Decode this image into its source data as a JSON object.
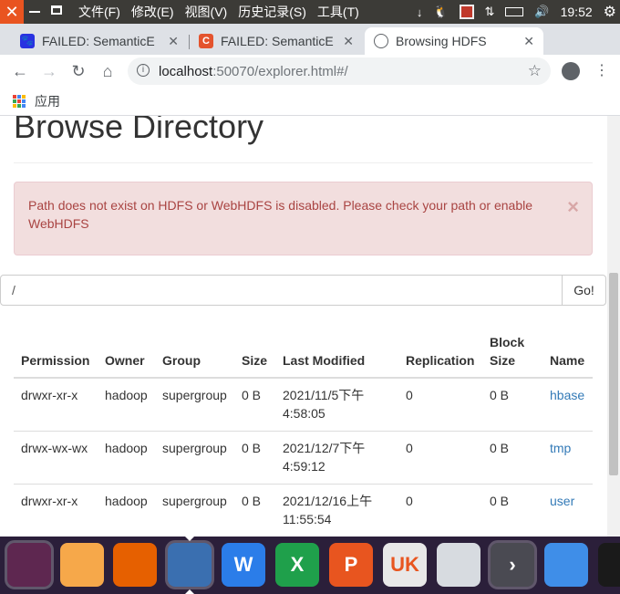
{
  "system_bar": {
    "menus": [
      "文件(F)",
      "修改(E)",
      "视图(V)",
      "历史记录(S)",
      "工具(T)"
    ],
    "clock": "19:52"
  },
  "tabs": [
    {
      "title": "FAILED: SemanticE",
      "favicon": "baidu-paw-icon",
      "active": false
    },
    {
      "title": "FAILED: SemanticE",
      "favicon": "c-letter-icon",
      "active": false
    },
    {
      "title": "Browsing HDFS",
      "favicon": "globe-icon",
      "active": true
    }
  ],
  "omnibox": {
    "host": "localhost",
    "rest": ":50070/explorer.html#/"
  },
  "bookmarks": {
    "apps_label": "应用"
  },
  "page": {
    "title": "Browse Directory",
    "alert": "Path does not exist on HDFS or WebHDFS is disabled. Please check your path or enable WebHDFS",
    "alert_close": "×",
    "path_value": "/",
    "go_label": "Go!",
    "columns": [
      "Permission",
      "Owner",
      "Group",
      "Size",
      "Last Modified",
      "Replication",
      "Block Size",
      "Name"
    ],
    "rows": [
      {
        "permission": "drwxr-xr-x",
        "owner": "hadoop",
        "group": "supergroup",
        "size": "0 B",
        "modified": "2021/11/5下午 4:58:05",
        "replication": "0",
        "block_size": "0 B",
        "name": "hbase"
      },
      {
        "permission": "drwx-wx-wx",
        "owner": "hadoop",
        "group": "supergroup",
        "size": "0 B",
        "modified": "2021/12/7下午 4:59:12",
        "replication": "0",
        "block_size": "0 B",
        "name": "tmp"
      },
      {
        "permission": "drwxr-xr-x",
        "owner": "hadoop",
        "group": "supergroup",
        "size": "0 B",
        "modified": "2021/12/16上午 11:55:54",
        "replication": "0",
        "block_size": "0 B",
        "name": "user"
      }
    ]
  },
  "dock": [
    {
      "name": "ubuntu-logo-icon",
      "color": "#5e2750"
    },
    {
      "name": "files-folder-icon",
      "color": "#f6a84a"
    },
    {
      "name": "firefox-icon",
      "color": "#e66000"
    },
    {
      "name": "chromium-icon",
      "color": "#3a6fb0"
    },
    {
      "name": "wps-writer-icon",
      "color": "#2b7de9",
      "label": "W"
    },
    {
      "name": "wps-spreadsheet-icon",
      "color": "#1fa04b",
      "label": "X"
    },
    {
      "name": "wps-presentation-icon",
      "color": "#e8551f",
      "label": "P"
    },
    {
      "name": "ubuntu-kylin-software-icon",
      "color": "#e8e8e8",
      "label": "UK"
    },
    {
      "name": "android-studio-icon",
      "color": "#d7dbe0"
    },
    {
      "name": "terminal-arrow-icon",
      "color": "#4a4a52",
      "label": "›"
    },
    {
      "name": "app-grid-icon",
      "color": "#3f8ee8"
    },
    {
      "name": "settings-dial-icon",
      "color": "#1a1a1a"
    }
  ]
}
